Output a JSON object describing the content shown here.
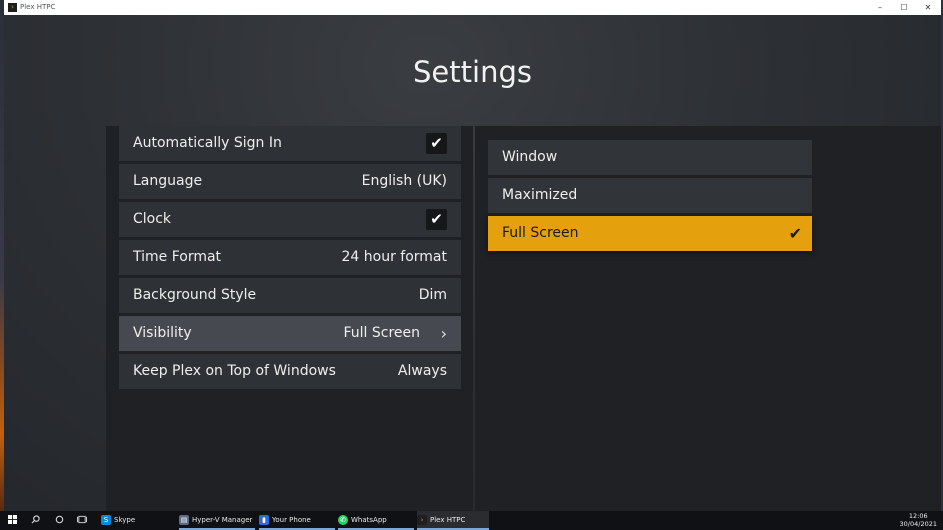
{
  "window": {
    "title": "Plex HTPC",
    "icon": "plex-chevron-icon",
    "controls": {
      "minimize": "–",
      "maximize": "☐",
      "close": "✕"
    }
  },
  "page": {
    "title": "Settings"
  },
  "settings": [
    {
      "label": "Automatically Sign In",
      "type": "checkbox",
      "checked": true
    },
    {
      "label": "Language",
      "type": "value",
      "value": "English (UK)"
    },
    {
      "label": "Clock",
      "type": "checkbox",
      "checked": true
    },
    {
      "label": "Time Format",
      "type": "value",
      "value": "24 hour format"
    },
    {
      "label": "Background Style",
      "type": "value",
      "value": "Dim"
    },
    {
      "label": "Visibility",
      "type": "value",
      "value": "Full Screen",
      "selected": true,
      "chevron": "›"
    },
    {
      "label": "Keep Plex on Top of Windows",
      "type": "value",
      "value": "Always"
    }
  ],
  "visibility_options": [
    {
      "label": "Window",
      "active": false
    },
    {
      "label": "Maximized",
      "active": false
    },
    {
      "label": "Full Screen",
      "active": true
    }
  ],
  "check_glyph": "✔",
  "colors": {
    "accent": "#e5a00d",
    "background": "#2b2e33",
    "row": "#2e3135",
    "row_selected": "#464a50"
  },
  "taskbar": {
    "start_icon": "windows-start-icon",
    "search_icon": "search-icon",
    "cortana_icon": "cortana-icon",
    "taskview_icon": "task-view-icon",
    "apps": [
      {
        "label": "Skype",
        "icon": "skype-icon",
        "glyph": "S",
        "color": "#0b8ad8"
      },
      {
        "label": "Hyper-V Manager",
        "icon": "hyper-v-icon",
        "glyph": "▤",
        "color": "#5b6a86"
      },
      {
        "label": "Your Phone",
        "icon": "phone-icon",
        "glyph": "▮",
        "color": "#2d6bd6"
      },
      {
        "label": "WhatsApp",
        "icon": "whatsapp-icon",
        "glyph": "✆",
        "color": "#25d366"
      },
      {
        "label": "Plex HTPC",
        "icon": "plex-icon",
        "glyph": "›",
        "color": "#1f1f1f"
      }
    ],
    "clock": {
      "time": "12:06",
      "date": "30/04/2021"
    }
  }
}
